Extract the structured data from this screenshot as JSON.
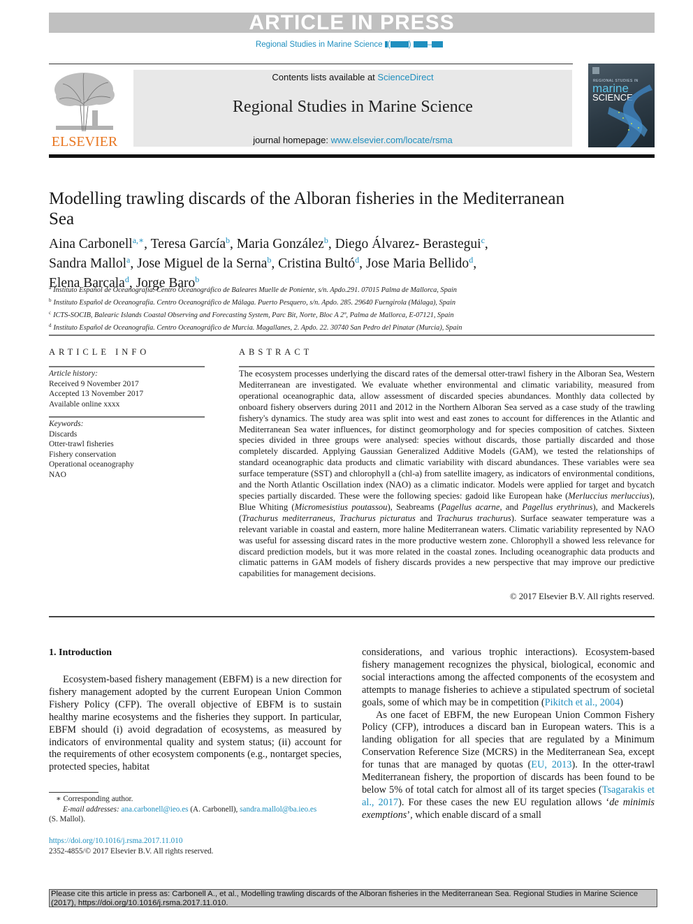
{
  "banner": {
    "text": "ARTICLE IN PRESS"
  },
  "journal_ref": {
    "text": "Regional Studies in Marine Science",
    "volume_placeholder": "(",
    "volume_close": ")",
    "dash": "–"
  },
  "header": {
    "publisher": "ELSEVIER",
    "contents_prefix": "Contents lists available at ",
    "contents_link": "ScienceDirect",
    "journal_title": "Regional Studies in Marine Science",
    "homepage_prefix": "journal homepage: ",
    "homepage_link": "www.elsevier.com/locate/rsma",
    "cover": {
      "small_text": "REGIONAL STUDIES IN",
      "word1": "marine",
      "word2": "SCIENCE"
    }
  },
  "paper": {
    "title": "Modelling trawling discards of the Alboran fisheries in the Mediterranean Sea",
    "authors": [
      {
        "name": "Aina Carbonell",
        "aff": "a,∗",
        "sep": ", "
      },
      {
        "name": "Teresa García",
        "aff": "b",
        "sep": ", "
      },
      {
        "name": "Maria González",
        "aff": "b",
        "sep": ", "
      },
      {
        "name": "Diego Álvarez- Berastegui",
        "aff": "c",
        "sep": ", "
      },
      {
        "name": "Sandra Mallol",
        "aff": "a",
        "sep": ", "
      },
      {
        "name": "Jose Miguel de la Serna",
        "aff": "b",
        "sep": ", "
      },
      {
        "name": "Cristina Bultó",
        "aff": "d",
        "sep": ", "
      },
      {
        "name": "Jose Maria Bellido",
        "aff": "d",
        "sep": ", "
      },
      {
        "name": "Elena Barcala",
        "aff": "d",
        "sep": ", "
      },
      {
        "name": "Jorge Baro",
        "aff": "b",
        "sep": ""
      }
    ],
    "affiliations": [
      {
        "key": "a",
        "text": "Instituto Español de Oceanografía. Centro Oceanográfico de Baleares Muelle de Poniente, s/n. Apdo.291. 07015 Palma de Mallorca, Spain"
      },
      {
        "key": "b",
        "text": "Instituto Español de Oceanografía. Centro Oceanográfico de Málaga. Puerto Pesquero, s/n. Apdo. 285. 29640 Fuengirola (Málaga), Spain"
      },
      {
        "key": "c",
        "text": "ICTS-SOCIB, Balearic Islands Coastal Observing and Forecasting System, Parc Bit, Norte, Bloc A 2º, Palma de Mallorca, E-07121, Spain"
      },
      {
        "key": "d",
        "text": "Instituto Español de Oceanografía. Centro Oceanográfico de Murcia. Magallanes, 2. Apdo. 22. 30740 San Pedro del Pinatar (Murcia), Spain"
      }
    ]
  },
  "article_info": {
    "heading": "ARTICLE INFO",
    "history_label": "Article history:",
    "history": [
      "Received 9 November 2017",
      "Accepted 13 November 2017",
      "Available online xxxx"
    ],
    "keywords_label": "Keywords:",
    "keywords": [
      "Discards",
      "Otter-trawl fisheries",
      "Fishery conservation",
      "Operational oceanography",
      "NAO"
    ]
  },
  "abstract": {
    "heading": "ABSTRACT",
    "parts": [
      {
        "t": "The ecosystem processes underlying the discard rates of the demersal otter-trawl fishery in the Alboran Sea, Western Mediterranean are investigated. We evaluate whether environmental and climatic variability, measured from operational oceanographic data, allow assessment of discarded species abundances. Monthly data collected by onboard fishery observers during 2011 and 2012 in the Northern Alboran Sea served as a case study of the trawling fishery's dynamics. The study area was split into west and east zones to account for differences in the Atlantic and Mediterranean Sea water influences, for distinct geomorphology and for species composition of catches. Sixteen species divided in three groups were analysed: species without discards, those partially discarded and those completely discarded. Applying Gaussian Generalized Additive Models (GAM), we tested the relationships of standard oceanographic data products and climatic variability with discard abundances. These variables were sea surface temperature (SST) and chlorophyll a (chl-a) from satellite imagery, as indicators of environmental conditions, and the North Atlantic Oscillation index (NAO) as a climatic indicator. Models were applied for target and bycatch species partially discarded. These were the following species: gadoid like European hake (",
        "i": false
      },
      {
        "t": "Merluccius merluccius",
        "i": true
      },
      {
        "t": "), Blue Whiting (",
        "i": false
      },
      {
        "t": "Micromesistius poutassou",
        "i": true
      },
      {
        "t": "), Seabreams (",
        "i": false
      },
      {
        "t": "Pagellus acarne",
        "i": true
      },
      {
        "t": ", and ",
        "i": false
      },
      {
        "t": "Pagellus erythrinus",
        "i": true
      },
      {
        "t": "), and Mackerels (",
        "i": false
      },
      {
        "t": "Trachurus mediterraneus",
        "i": true
      },
      {
        "t": ", ",
        "i": false
      },
      {
        "t": "Trachurus picturatus",
        "i": true
      },
      {
        "t": " and ",
        "i": false
      },
      {
        "t": "Trachurus trachurus",
        "i": true
      },
      {
        "t": "). Surface seawater temperature was a relevant variable in coastal and eastern, more haline Mediterranean waters. Climatic variability represented by NAO was useful for assessing discard rates in the more productive western zone. Chlorophyll a showed less relevance for discard prediction models, but it was more related in the coastal zones. Including oceanographic data products and climatic patterns in GAM models of fishery discards provides a new perspective that may improve our predictive capabilities for management decisions.",
        "i": false
      }
    ],
    "copyright": "© 2017 Elsevier B.V. All rights reserved."
  },
  "intro": {
    "heading": "1. Introduction",
    "left_p1": "Ecosystem-based fishery management (EBFM) is a new direction for fishery management adopted by the current European Union Common Fishery Policy (CFP). The overall objective of EBFM is to sustain healthy marine ecosystems and the fisheries they support. In particular, EBFM should (i) avoid degradation of ecosystems, as measured by indicators of environmental quality and system status; (ii) account for the requirements of other ecosystem components (e.g., nontarget species, protected species, habitat",
    "right_p1_a": "considerations, and various trophic interactions). Ecosystem-based fishery management recognizes the physical, biological, economic and social interactions among the affected components of the ecosystem and attempts to manage fisheries to achieve a stipulated spectrum of societal goals, some of which may be in competition (",
    "right_p1_ref": "Pikitch et al., 2004",
    "right_p1_b": ")",
    "right_p2_a": "As one facet of EBFM, the new European Union Common Fishery Policy (CFP), introduces a discard ban in European waters. This is a landing obligation for all species that are regulated by a Minimum Conservation Reference Size (MCRS) in the Mediterranean Sea, except for tunas that are managed by quotas (",
    "right_p2_ref1": "EU, 2013",
    "right_p2_b": "). In the otter-trawl Mediterranean fishery, the proportion of discards has been found to be below 5% of total catch for almost all of its target species (",
    "right_p2_ref2": "Tsagarakis et al., 2017",
    "right_p2_c": "). For these cases the new EU regulation allows ‘",
    "right_p2_it": "de minimis exemptions",
    "right_p2_d": "’, which enable discard of a small"
  },
  "footnotes": {
    "star": "∗",
    "corresponding": "Corresponding author.",
    "email_label": "E-mail addresses: ",
    "email1": "ana.carbonell@ieo.es",
    "email1_name": " (A. Carbonell), ",
    "email2": "sandra.mallol@ba.ieo.es",
    "email2_name": "(S. Mallol).",
    "doi": "https://doi.org/10.1016/j.rsma.2017.11.010",
    "issn": "2352-4855/© 2017 Elsevier B.V. All rights reserved."
  },
  "citation_box": {
    "text": "Please cite this article in press as: Carbonell A., et al., Modelling trawling discards of the Alboran fisheries in the Mediterranean Sea. Regional Studies in Marine Science (2017), https://doi.org/10.1016/j.rsma.2017.11.010."
  },
  "colors": {
    "link": "#1f8fbf",
    "elsevier_orange": "#e87722",
    "banner_grey": "#c0c0c0"
  }
}
